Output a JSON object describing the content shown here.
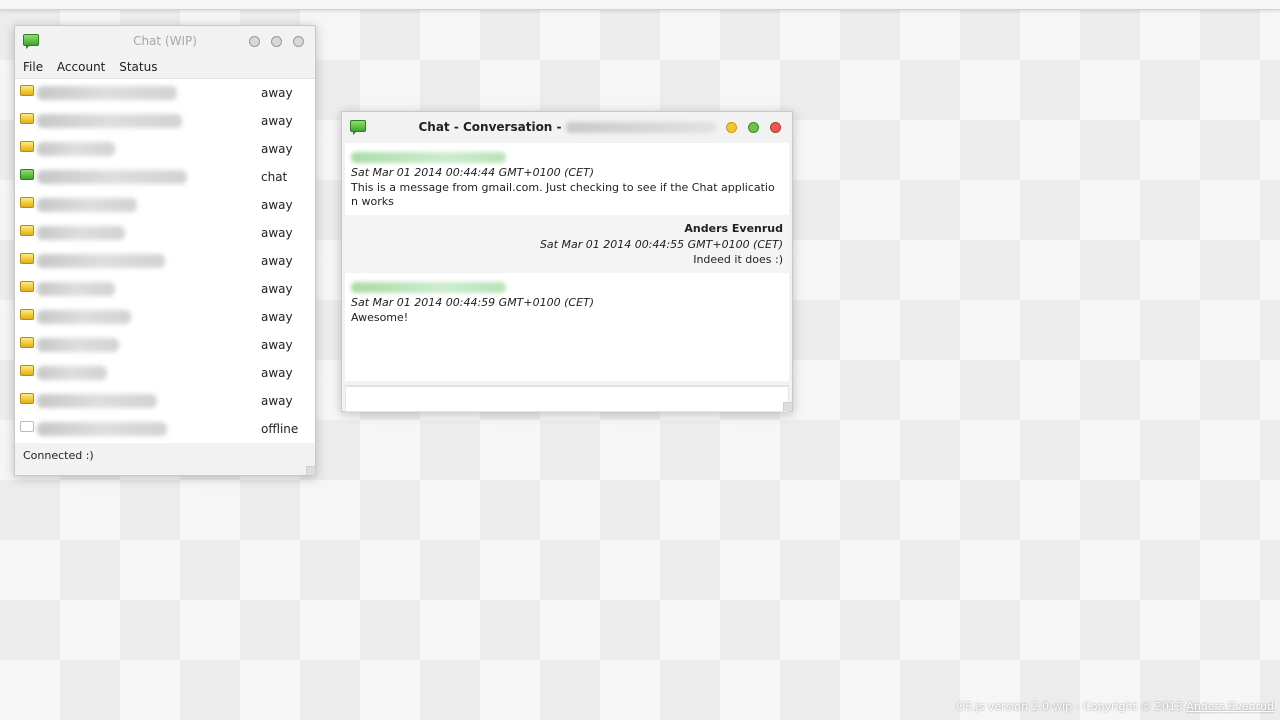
{
  "desktop": {
    "footer_text": "OS.js version 2.0-wip - Copyright © 2013",
    "footer_link": "Anders Evenrud"
  },
  "chat_window": {
    "title": "Chat (WIP)",
    "icon": "chat-bubble-icon",
    "menu": [
      "File",
      "Account",
      "Status"
    ],
    "contacts": [
      {
        "status": "away",
        "icon": "away-bubble-icon"
      },
      {
        "status": "away",
        "icon": "away-bubble-icon"
      },
      {
        "status": "away",
        "icon": "away-bubble-icon"
      },
      {
        "status": "chat",
        "icon": "chat-bubble-icon"
      },
      {
        "status": "away",
        "icon": "away-bubble-icon"
      },
      {
        "status": "away",
        "icon": "away-bubble-icon"
      },
      {
        "status": "away",
        "icon": "away-bubble-icon"
      },
      {
        "status": "away",
        "icon": "away-bubble-icon"
      },
      {
        "status": "away",
        "icon": "away-bubble-icon"
      },
      {
        "status": "away",
        "icon": "away-bubble-icon"
      },
      {
        "status": "away",
        "icon": "away-bubble-icon"
      },
      {
        "status": "away",
        "icon": "away-bubble-icon"
      },
      {
        "status": "offline",
        "icon": "offline-icon"
      }
    ],
    "status_text": "Connected :)"
  },
  "conversation_window": {
    "title": "Chat - Conversation -",
    "icon": "chat-bubble-icon",
    "messages": [
      {
        "from": "",
        "time": "Sat Mar 01 2014 00:44:44 GMT+0100 (CET)",
        "text": "This is a message from gmail.com. Just checking to see if the Chat applicatio n works",
        "own": false
      },
      {
        "from": "Anders Evenrud",
        "time": "Sat Mar 01 2014 00:44:55 GMT+0100 (CET)",
        "text": "Indeed it does :)",
        "own": true
      },
      {
        "from": "",
        "time": "Sat Mar 01 2014 00:44:59 GMT+0100 (CET)",
        "text": "Awesome!",
        "own": false
      }
    ],
    "input_value": ""
  },
  "colors": {
    "away": "#e8c02a",
    "chat": "#4fb43a",
    "minimize": "#f5c431",
    "maximize": "#69c447",
    "close": "#ec5a4d"
  }
}
